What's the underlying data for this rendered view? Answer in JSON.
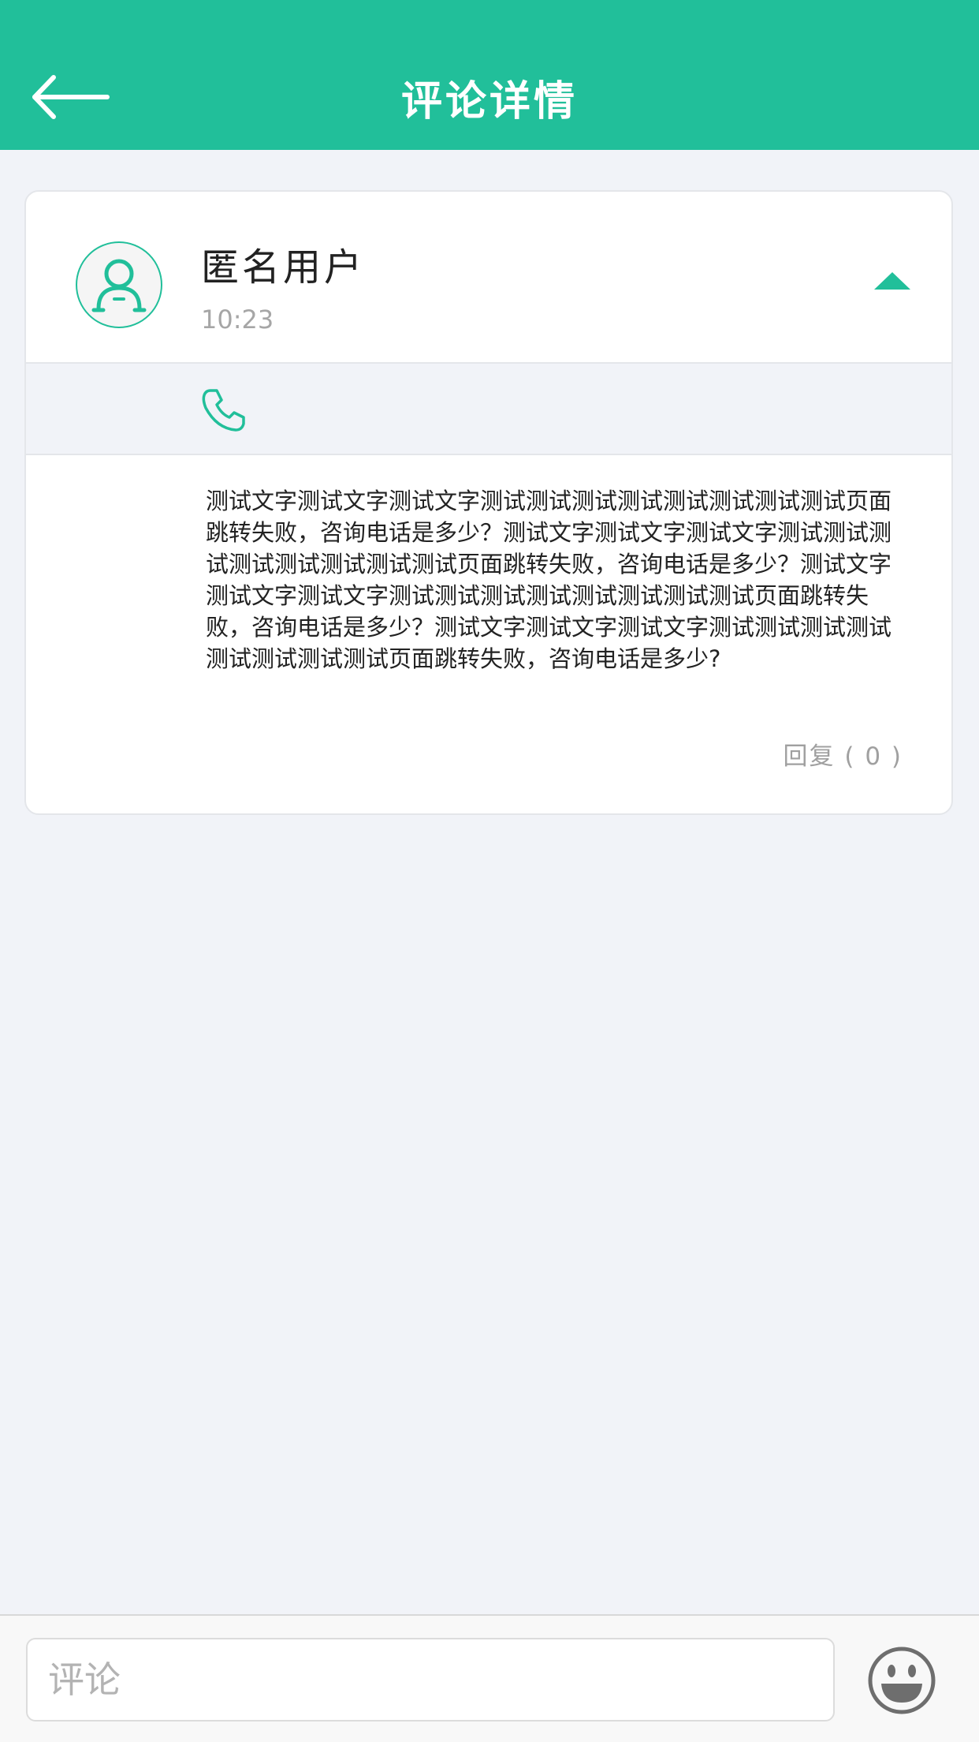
{
  "header": {
    "title": "评论详情",
    "back_icon": "arrow-left-icon"
  },
  "comment": {
    "user_name": "匿名用户",
    "time": "10:23",
    "avatar_icon": "user-avatar-icon",
    "collapse_icon": "triangle-up-icon",
    "phone_icon": "phone-icon",
    "text": "测试文字测试文字测试文字测试测试测试测试测试测试测试测试页面跳转失败，咨询电话是多少？测试文字测试文字测试文字测试测试测试测试测试测试测试测试页面跳转失败，咨询电话是多少？测试文字测试文字测试文字测试测试测试测试测试测试测试测试页面跳转失败，咨询电话是多少？测试文字测试文字测试文字测试测试测试测试测试测试测试测试页面跳转失败，咨询电话是多少?",
    "reply_label": "回复 ( 0 )"
  },
  "bottom_bar": {
    "input_placeholder": "评论",
    "input_value": "",
    "emoji_icon": "smiley-icon"
  },
  "colors": {
    "accent": "#21bf9a",
    "background": "#f1f3f8",
    "text_primary": "#222222",
    "text_secondary": "#a6a6a6"
  }
}
